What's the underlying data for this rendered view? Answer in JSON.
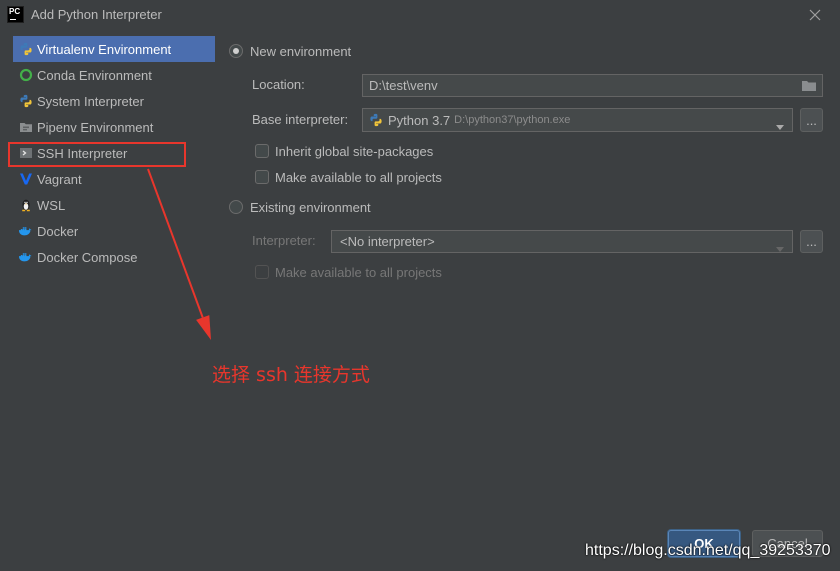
{
  "window": {
    "app_icon": "pycharm-icon",
    "app_icon_text": "PC",
    "title": "Add Python Interpreter",
    "close_icon": "close-icon"
  },
  "sidebar": {
    "items": [
      {
        "label": "Virtualenv Environment",
        "icon": "virtualenv-icon",
        "selected": true
      },
      {
        "label": "Conda Environment",
        "icon": "conda-icon",
        "selected": false
      },
      {
        "label": "System Interpreter",
        "icon": "python-icon",
        "selected": false
      },
      {
        "label": "Pipenv Environment",
        "icon": "pipenv-icon",
        "selected": false
      },
      {
        "label": "SSH Interpreter",
        "icon": "ssh-terminal-icon",
        "selected": false,
        "highlighted": true
      },
      {
        "label": "Vagrant",
        "icon": "vagrant-icon",
        "selected": false
      },
      {
        "label": "WSL",
        "icon": "linux-penguin-icon",
        "selected": false
      },
      {
        "label": "Docker",
        "icon": "docker-icon",
        "selected": false
      },
      {
        "label": "Docker Compose",
        "icon": "docker-compose-icon",
        "selected": false
      }
    ]
  },
  "new_environment": {
    "label": "New environment",
    "selected": true,
    "location": {
      "label": "Location:",
      "value": "D:\\test\\venv",
      "icon": "folder-icon"
    },
    "base_interpreter": {
      "label": "Base interpreter:",
      "name": "Python 3.7",
      "path": "D:\\python37\\python.exe",
      "icon": "python-icon",
      "browse_label": "..."
    },
    "inherit_global": {
      "label": "Inherit global site-packages",
      "checked": false
    },
    "make_available": {
      "label": "Make available to all projects",
      "checked": false
    }
  },
  "existing_environment": {
    "label": "Existing environment",
    "selected": false,
    "interpreter": {
      "label": "Interpreter:",
      "value": "<No interpreter>",
      "browse_label": "...",
      "enabled": false
    },
    "make_available": {
      "label": "Make available to all projects",
      "checked": false,
      "enabled": false
    }
  },
  "annotation": {
    "text": "选择 ssh 连接方式"
  },
  "buttons": {
    "ok_label": "OK",
    "cancel_label": "Cancel",
    "ok_is_default": true
  },
  "watermark": "https://blog.csdn.net/qq_39253370",
  "colors": {
    "background": "#3c3f41",
    "text": "#bbbbbb",
    "selection": "#4b6eaf",
    "selection_text": "#ffffff",
    "annotation": "#e8362c",
    "disabled_text": "#777777",
    "secondary_text": "#8c8c8c"
  }
}
